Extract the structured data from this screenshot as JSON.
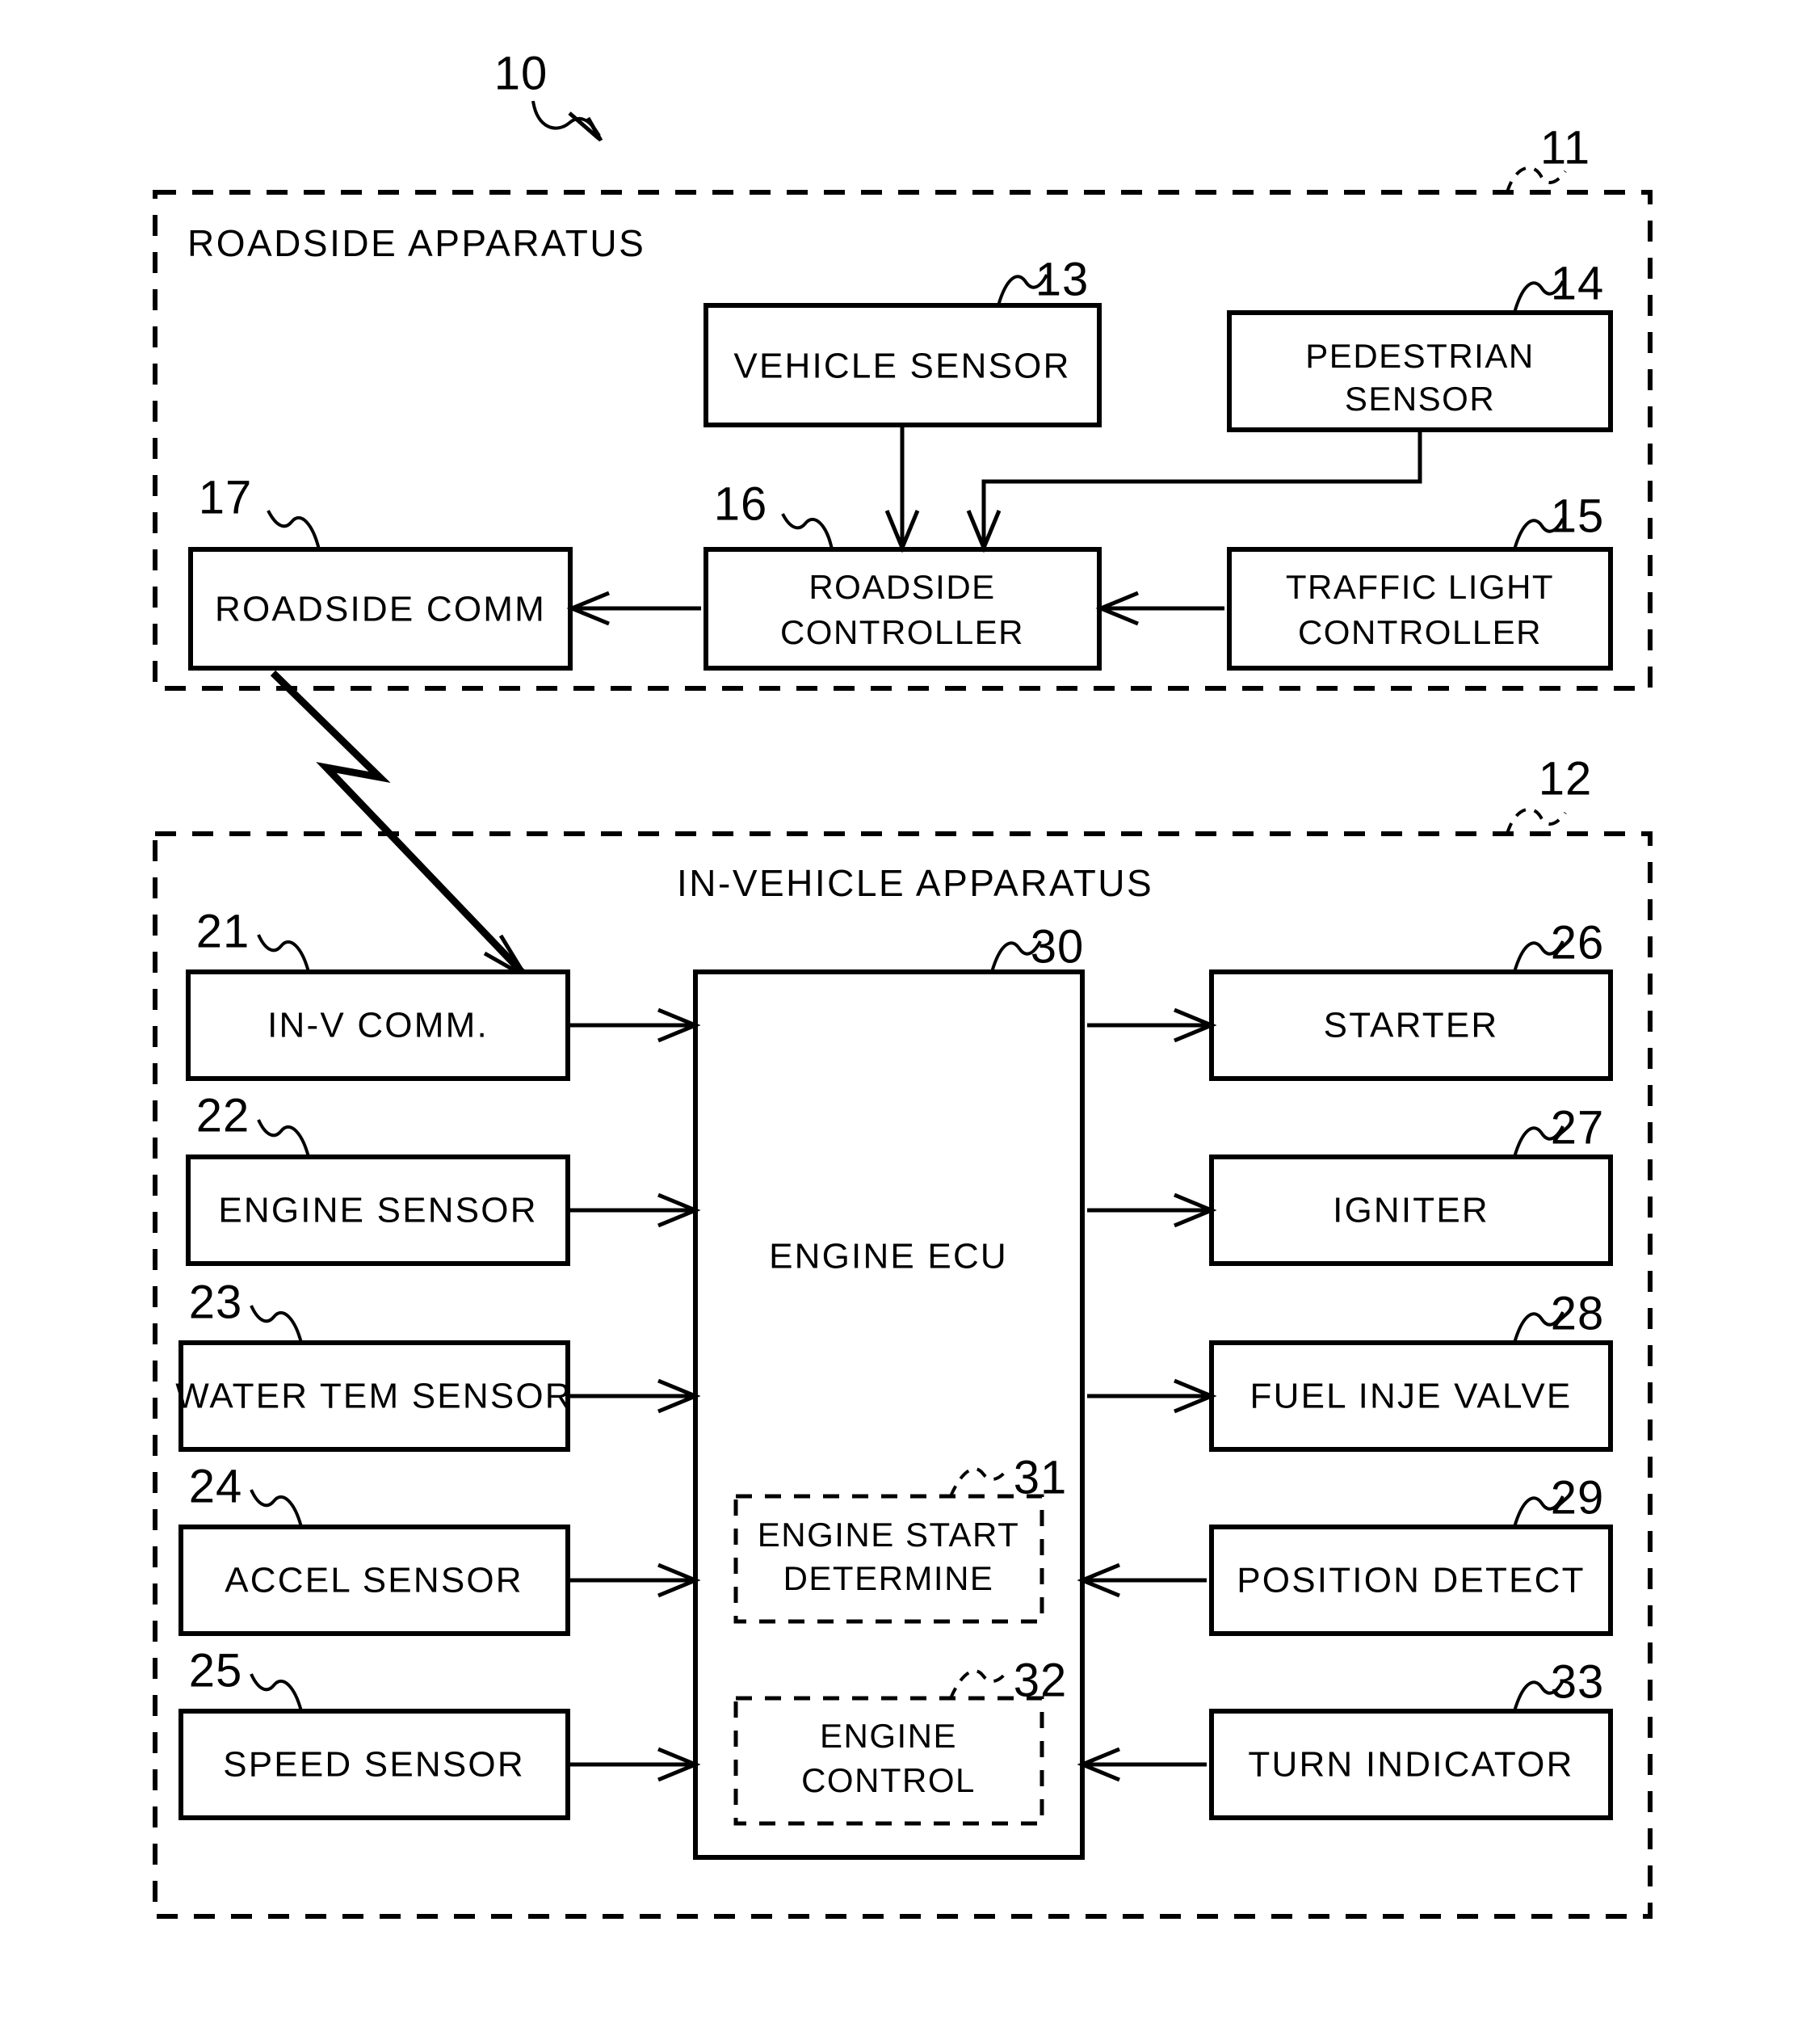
{
  "figure": {
    "reference_numeral": "10",
    "roadside": {
      "title": "ROADSIDE APPARATUS",
      "ref": "11",
      "blocks": [
        {
          "id": "vehicle-sensor",
          "ref": "13",
          "lines": [
            "VEHICLE SENSOR"
          ]
        },
        {
          "id": "pedestrian-sensor",
          "ref": "14",
          "lines": [
            "PEDESTRIAN",
            "SENSOR"
          ]
        },
        {
          "id": "roadside-comm",
          "ref": "17",
          "lines": [
            "ROADSIDE COMM"
          ]
        },
        {
          "id": "roadside-controller",
          "ref": "16",
          "lines": [
            "ROADSIDE",
            "CONTROLLER"
          ]
        },
        {
          "id": "traffic-light-controller",
          "ref": "15",
          "lines": [
            "TRAFFIC LIGHT",
            "CONTROLLER"
          ]
        }
      ]
    },
    "invehicle": {
      "title": "IN-VEHICLE APPARATUS",
      "ref": "12",
      "ecu": {
        "id": "engine-ecu",
        "ref": "30",
        "lines": [
          "ENGINE ECU"
        ],
        "submodules": [
          {
            "id": "engine-start-determine",
            "ref": "31",
            "lines": [
              "ENGINE START",
              "DETERMINE"
            ]
          },
          {
            "id": "engine-control",
            "ref": "32",
            "lines": [
              "ENGINE",
              "CONTROL"
            ]
          }
        ]
      },
      "inputs": [
        {
          "id": "in-v-comm",
          "ref": "21",
          "lines": [
            "IN-V COMM."
          ]
        },
        {
          "id": "engine-sensor",
          "ref": "22",
          "lines": [
            "ENGINE SENSOR"
          ]
        },
        {
          "id": "water-tem-sensor",
          "ref": "23",
          "lines": [
            "WATER TEM SENSOR"
          ]
        },
        {
          "id": "accel-sensor",
          "ref": "24",
          "lines": [
            "ACCEL SENSOR"
          ]
        },
        {
          "id": "speed-sensor",
          "ref": "25",
          "lines": [
            "SPEED SENSOR"
          ]
        }
      ],
      "outputs": [
        {
          "id": "starter",
          "ref": "26",
          "lines": [
            "STARTER"
          ]
        },
        {
          "id": "igniter",
          "ref": "27",
          "lines": [
            "IGNITER"
          ]
        },
        {
          "id": "fuel-inje-valve",
          "ref": "28",
          "lines": [
            "FUEL INJE VALVE"
          ]
        },
        {
          "id": "position-detect",
          "ref": "29",
          "lines": [
            "POSITION DETECT"
          ]
        },
        {
          "id": "turn-indicator",
          "ref": "33",
          "lines": [
            "TURN INDICATOR"
          ]
        }
      ]
    },
    "colors": {
      "ink": "#000000",
      "paper": "#ffffff"
    }
  }
}
